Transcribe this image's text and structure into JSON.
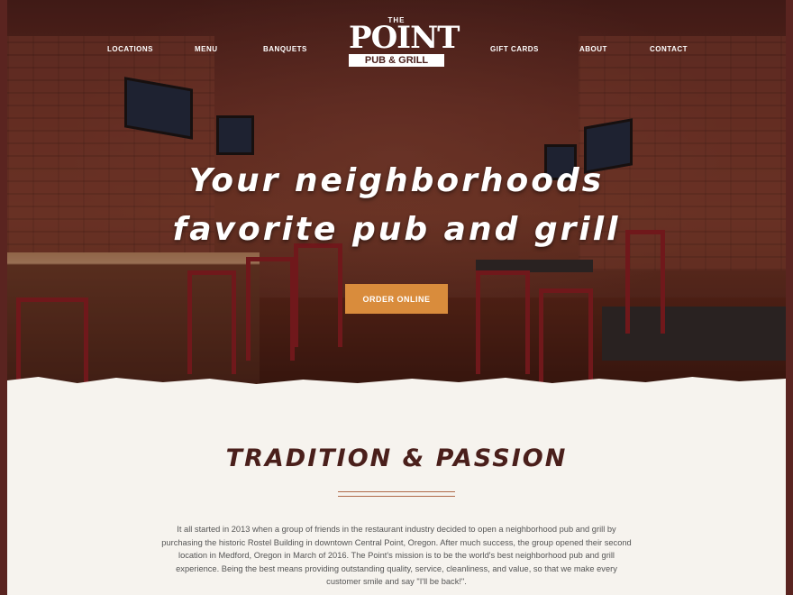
{
  "nav": {
    "left": [
      "LOCATIONS",
      "MENU",
      "BANQUETS"
    ],
    "right": [
      "GIFT CARDS",
      "ABOUT",
      "CONTACT"
    ]
  },
  "logo": {
    "the": "THE",
    "point": "POINT",
    "sub": "PUB & GRILL"
  },
  "hero": {
    "title_line1": "Your neighborhoods",
    "title_line2": "favorite pub and grill",
    "cta": "ORDER ONLINE"
  },
  "section": {
    "title": "TRADITION & PASSION",
    "body": "It all started in 2013 when a group of friends in the restaurant industry decided to open a neighborhood pub and grill by purchasing the historic Rostel Building in downtown Central Point, Oregon. After much success, the group opened their second location in Medford, Oregon in March of 2016. The Point's mission is to be the world's best neighborhood pub and grill experience. Being the best means providing outstanding quality, service, cleanliness, and value, so that we make every customer smile and say \"I'll be back!\"."
  },
  "colors": {
    "brand": "#4a1f1b",
    "accent": "#d98c3c",
    "background": "#f6f3ee"
  }
}
